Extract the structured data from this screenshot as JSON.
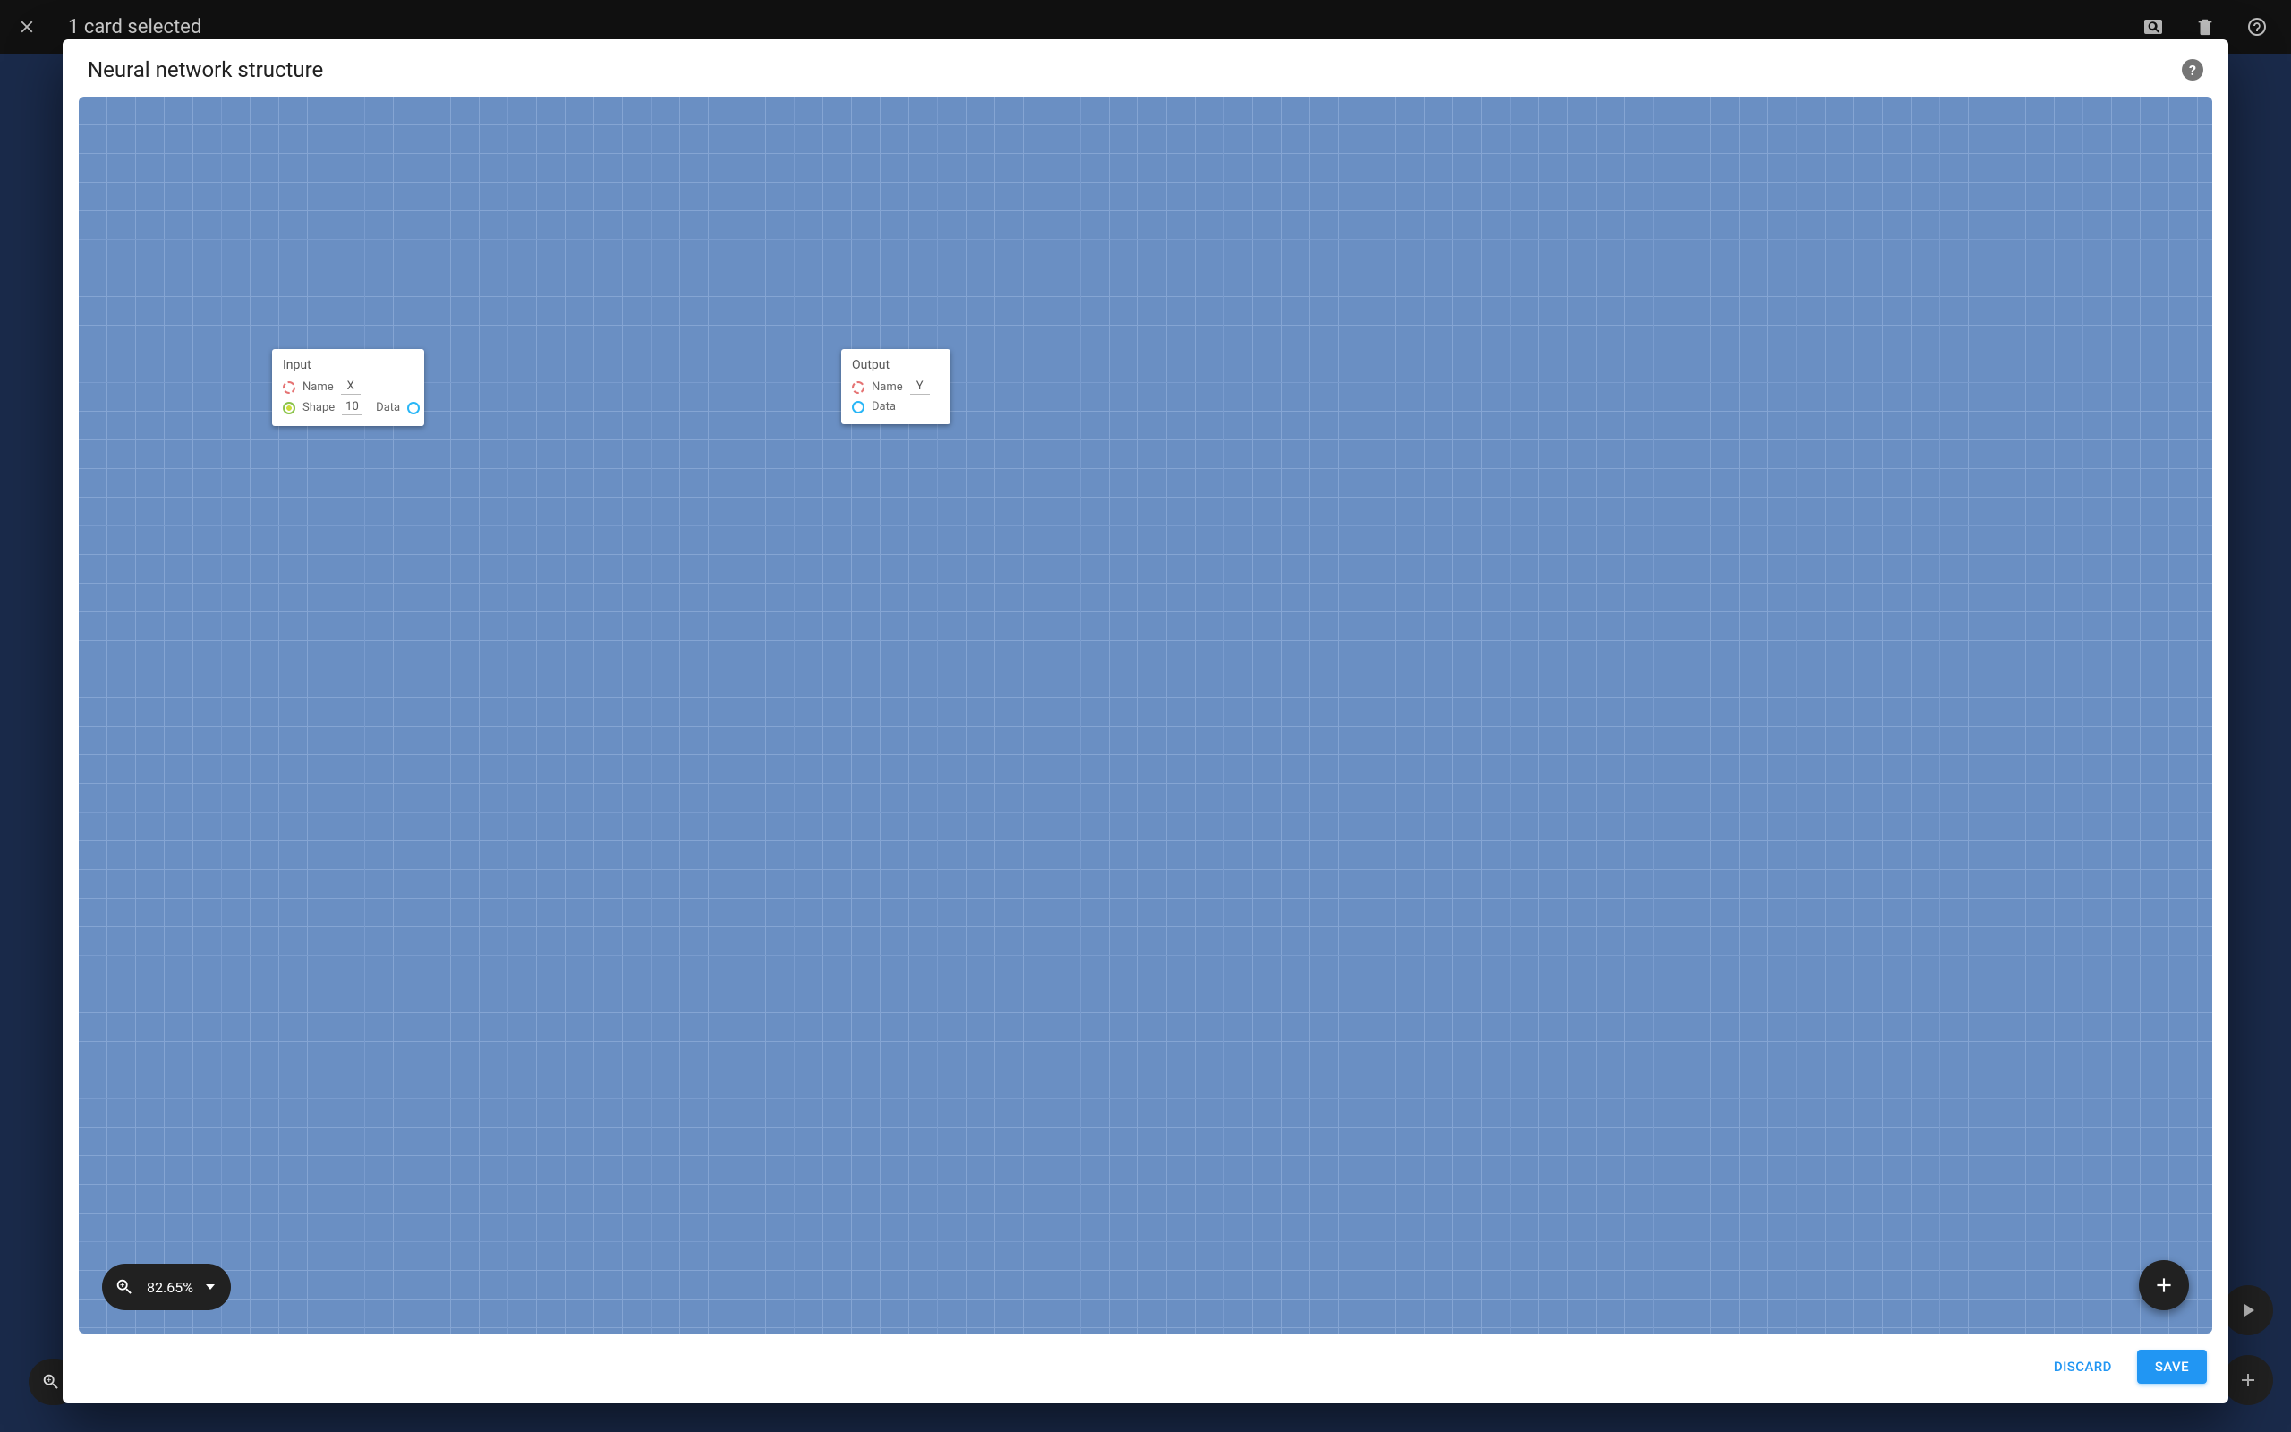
{
  "appbar": {
    "title": "1 card selected"
  },
  "modal": {
    "title": "Neural network structure",
    "discard_label": "DISCARD",
    "save_label": "SAVE"
  },
  "canvas": {
    "zoom": "82.65%",
    "nodes": {
      "input": {
        "title": "Input",
        "name_label": "Name",
        "name_value": "X",
        "shape_label": "Shape",
        "shape_value": "10",
        "data_label": "Data"
      },
      "output": {
        "title": "Output",
        "name_label": "Name",
        "name_value": "Y",
        "data_label": "Data"
      }
    }
  }
}
